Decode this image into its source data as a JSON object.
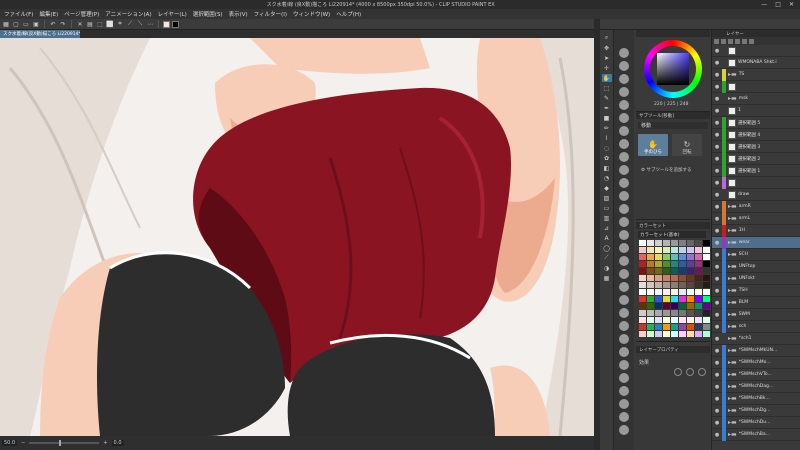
{
  "window": {
    "title": "スク水着/線 (良X動)描ころ Li220914* (4000 x 8500px 350dpi 50.0%) - CLIP STUDIO PAINT EX",
    "btn_min": "—",
    "btn_max": "□",
    "btn_close": "✕"
  },
  "menu": [
    "ファイル(F)",
    "編集(E)",
    "ページ管理(P)",
    "アニメーション(A)",
    "レイヤー(L)",
    "選択範囲(S)",
    "表示(V)",
    "フィルター(I)",
    "ウィンドウ(W)",
    "ヘルプ(H)"
  ],
  "document_tab": "スク水着/線(良X動)描ころ Li220914*",
  "canvas_colors": {
    "background": "#f3f0ee",
    "skin": "#f7cdb8",
    "skin_shadow": "#ecab8f",
    "swimsuit": "#8b1422",
    "swimsuit_shadow": "#5f0b16",
    "shorts": "#2d2d2d",
    "hair": "#e5ddd6"
  },
  "status": {
    "zoom": "50.0",
    "angle": "0.0"
  },
  "color_panel": {
    "values": "220 | 225 | 248",
    "hue_value": "0"
  },
  "subtool_panel": {
    "title": "サブツール[移動]",
    "group": "移動",
    "item_selected": "手のひら",
    "item_other": "回転",
    "add_label": "サブツールを追加する"
  },
  "swatch_panel": {
    "title": "カラーセット",
    "set_name": "カラーセット(基本)",
    "colors": [
      "#ffffff",
      "#e8e8e8",
      "#cfcfcf",
      "#b3b3b3",
      "#999999",
      "#7f7f7f",
      "#666666",
      "#4c4c4c",
      "#000000",
      "#f2c9c9",
      "#f7e3b5",
      "#f9f1b8",
      "#d8ecbc",
      "#bde4e0",
      "#bcd3ef",
      "#cfc4ea",
      "#ecc3df",
      "#ffffff",
      "#e06464",
      "#e8a94f",
      "#e9d95c",
      "#8fc96a",
      "#5fbcb4",
      "#5d8ed6",
      "#8e74cc",
      "#cf6aab",
      "#ffffff",
      "#b22222",
      "#b87a22",
      "#b5a52a",
      "#4f8f2e",
      "#23877f",
      "#285ea8",
      "#5c3f9c",
      "#9b2f78",
      "#000000",
      "#7a1414",
      "#7a4f14",
      "#77691a",
      "#2e5f19",
      "#125a54",
      "#173d70",
      "#3a2468",
      "#681c4f",
      "#333333",
      "#f8d3c0",
      "#eeb89d",
      "#dba082",
      "#c98264",
      "#b5694f",
      "#8f4d38",
      "#6c3425",
      "#4a2318",
      "#2b140d",
      "#e5ddd6",
      "#d2c7bd",
      "#bfb1a5",
      "#a8978a",
      "#8d7c70",
      "#726256",
      "#56483f",
      "#3b302a",
      "#221b17",
      "#ffffff",
      "#fffaf0",
      "#f0f8ff",
      "#fff0f5",
      "#f5f5dc",
      "#e6e6fa",
      "#f0fff0",
      "#fffff0",
      "#f5fffa",
      "#dd3333",
      "#33aa33",
      "#3355dd",
      "#dddd33",
      "#33dddd",
      "#dd33dd",
      "#ff8800",
      "#8800ff",
      "#00ff88",
      "#663300",
      "#336600",
      "#003366",
      "#660033",
      "#330066",
      "#006633",
      "#996600",
      "#009966",
      "#660099",
      "#cccccc",
      "#bbbbbb",
      "#aaaaaa",
      "#999999",
      "#888888",
      "#777777",
      "#555555",
      "#444444",
      "#222222",
      "#ffe0e0",
      "#e0ffe0",
      "#e0e0ff",
      "#ffffe0",
      "#e0ffff",
      "#ffe0ff",
      "#fff0e0",
      "#f0e0ff",
      "#e0fff0",
      "#c0392b",
      "#27ae60",
      "#2980b9",
      "#f39c12",
      "#16a085",
      "#8e44ad",
      "#d35400",
      "#2c3e50",
      "#7f8c8d",
      "#ffcccc",
      "#ccffcc",
      "#ccccff",
      "#ffffcc",
      "#ccffff",
      "#ffccff",
      "#ffddaa",
      "#ddaaff",
      "#aaffdd"
    ]
  },
  "props_panel": {
    "title": "レイヤープロパティ",
    "effect": "効果"
  },
  "layer_panel": {
    "title": "レイヤー",
    "rows": [
      {
        "label": "",
        "mark": "",
        "thumb": true,
        "folder": false
      },
      {
        "label": "WMONABA Shkt.i",
        "mark": "",
        "thumb": true,
        "folder": false
      },
      {
        "label": "TS",
        "mark": "#d7d32f",
        "thumb": false,
        "folder": true
      },
      {
        "label": "",
        "mark": "#2fa22f",
        "thumb": true,
        "folder": false
      },
      {
        "label": "msk",
        "mark": "",
        "thumb": false,
        "folder": true
      },
      {
        "label": "1",
        "mark": "",
        "thumb": true,
        "folder": false
      },
      {
        "label": "選択範囲 5",
        "mark": "#2fa22f",
        "thumb": true,
        "folder": false
      },
      {
        "label": "選択範囲 4",
        "mark": "#2fa22f",
        "thumb": true,
        "folder": false
      },
      {
        "label": "選択範囲 3",
        "mark": "#2fa22f",
        "thumb": true,
        "folder": false
      },
      {
        "label": "選択範囲 2",
        "mark": "#2fa22f",
        "thumb": true,
        "folder": false
      },
      {
        "label": "選択範囲 1",
        "mark": "#2fa22f",
        "thumb": true,
        "folder": false
      },
      {
        "label": "",
        "mark": "#b66bd6",
        "thumb": true,
        "folder": false
      },
      {
        "label": "draw",
        "mark": "",
        "thumb": true,
        "folder": false
      },
      {
        "label": "armR",
        "mark": "#d4783a",
        "thumb": false,
        "folder": true
      },
      {
        "label": "armL",
        "mark": "#d4783a",
        "thumb": false,
        "folder": true
      },
      {
        "label": "1H",
        "mark": "#c02020",
        "thumb": false,
        "folder": true
      },
      {
        "label": "wear",
        "mark": "#8a3cc8",
        "thumb": false,
        "folder": true,
        "selected": true
      },
      {
        "label": "SCH",
        "mark": "#3a7cd4",
        "thumb": false,
        "folder": true
      },
      {
        "label": "UNFtop",
        "mark": "#3a7cd4",
        "thumb": false,
        "folder": true
      },
      {
        "label": "UNFskt",
        "mark": "#3a7cd4",
        "thumb": false,
        "folder": true
      },
      {
        "label": "TSH",
        "mark": "#3a7cd4",
        "thumb": false,
        "folder": true
      },
      {
        "label": "BLM",
        "mark": "#3a7cd4",
        "thumb": false,
        "folder": true
      },
      {
        "label": "SWM",
        "mark": "#3a7cd4",
        "thumb": false,
        "folder": true
      },
      {
        "label": "sch",
        "mark": "#3a7cd4",
        "thumb": false,
        "folder": true
      },
      {
        "label": "*sch1",
        "mark": "",
        "thumb": false,
        "folder": true
      },
      {
        "label": "*SWMschMkUN...",
        "mark": "#3a7cd4",
        "thumb": false,
        "folder": true
      },
      {
        "label": "*SWMschMo...",
        "mark": "#3a7cd4",
        "thumb": false,
        "folder": true
      },
      {
        "label": "*SWMschVTo...",
        "mark": "#3a7cd4",
        "thumb": false,
        "folder": true
      },
      {
        "label": "*SWMschDag...",
        "mark": "#3a7cd4",
        "thumb": false,
        "folder": true
      },
      {
        "label": "*SWMschBk...",
        "mark": "#3a7cd4",
        "thumb": false,
        "folder": true
      },
      {
        "label": "*SWMschDg...",
        "mark": "#3a7cd4",
        "thumb": false,
        "folder": true
      },
      {
        "label": "*SWMschDu...",
        "mark": "#3a7cd4",
        "thumb": false,
        "folder": true
      },
      {
        "label": "*SWMschBa...",
        "mark": "#3a7cd4",
        "thumb": false,
        "folder": true
      }
    ]
  }
}
